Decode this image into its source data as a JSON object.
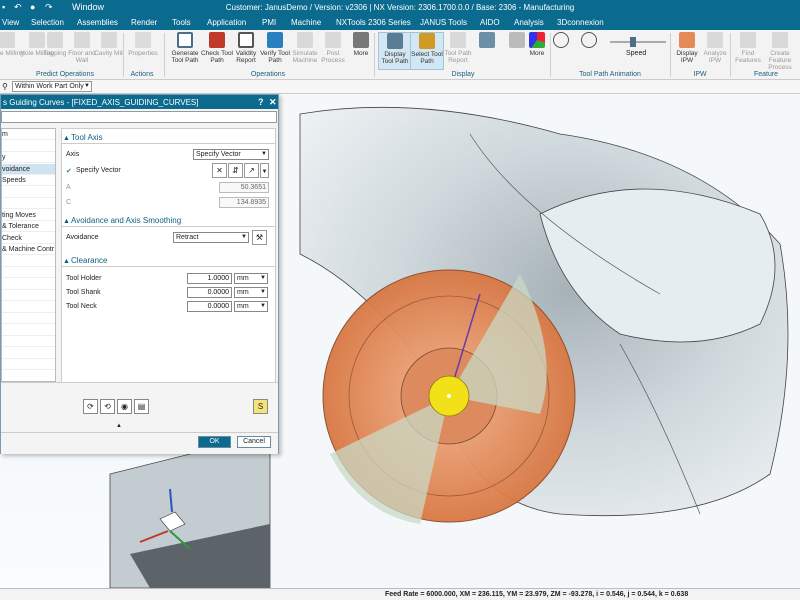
{
  "titlebar": {
    "title": "Customer: JanusDemo / Version: v2306 | NX Version: 2306.1700.0.0 / Base: 2306 - Manufacturing",
    "window_menu": "Window"
  },
  "menubar": {
    "items": [
      "View",
      "Selection",
      "Assemblies",
      "Render",
      "Tools",
      "Application",
      "PMI",
      "Machine",
      "NXTools 2306 Series",
      "JANUS Tools",
      "AIDO",
      "Analysis",
      "3Dconnexion"
    ]
  },
  "ribbon": {
    "groups": {
      "predict": "Predict Operations",
      "actions": "Actions",
      "operations": "Operations",
      "display": "Display",
      "animation": "Tool Path Animation",
      "ipw": "IPW",
      "feature": "Feature"
    },
    "buttons": {
      "hole_milling": "Hole Milling",
      "tapping": "Tapping",
      "floor_wall": "Floor and Wall",
      "cavity_mill": "Cavity Mill",
      "properties": "Properties",
      "generate": "Generate Tool Path",
      "check": "Check Tool Path",
      "validity": "Validity Report",
      "verify": "Verify Tool Path",
      "simulate": "Simulate Machine",
      "post": "Post Process",
      "more1": "More",
      "display_tp": "Display Tool Path",
      "select_tp": "Select Tool Path",
      "tp_report": "Tool Path Report",
      "more2": "More",
      "speed": "Speed",
      "display_ipw": "Display IPW",
      "analyze_ipw": "Analyze IPW",
      "find_features": "Find Features",
      "create_feature": "Create Feature Process"
    }
  },
  "filter": {
    "value": "Within Work Part Only"
  },
  "dialog": {
    "title": "s Guiding Curves - [FIXED_AXIS_GUIDING_CURVES]",
    "help": "?",
    "close": "✕",
    "nav_items": [
      "m",
      "",
      "y",
      "voidance",
      "Speeds",
      "",
      "",
      "ting Moves",
      "& Tolerance",
      "Check",
      "& Machine Contr",
      "",
      "",
      "",
      "",
      "",
      "",
      "",
      "",
      "",
      "",
      ""
    ],
    "nav_selected_index": 3,
    "tool_axis": {
      "header": "Tool Axis",
      "axis_label": "Axis",
      "axis_value": "Specify Vector",
      "specify_vector": "Specify Vector",
      "a_label": "A",
      "a_value": "50.3651",
      "c_label": "C",
      "c_value": "134.8935"
    },
    "avoidance": {
      "header": "Avoidance and Axis Smoothing",
      "label": "Avoidance",
      "value": "Retract"
    },
    "clearance": {
      "header": "Clearance",
      "rows": [
        {
          "label": "Tool Holder",
          "value": "1.0000",
          "unit": "mm"
        },
        {
          "label": "Tool Shank",
          "value": "0.0000",
          "unit": "mm"
        },
        {
          "label": "Tool Neck",
          "value": "0.0000",
          "unit": "mm"
        }
      ]
    },
    "ok": "OK",
    "cancel": "Cancel"
  },
  "status": {
    "text": "Feed Rate = 6000.000, XM = 236.115, YM = 23.979, ZM = -93.278, i = 0.546, j = 0.544, k = 0.638"
  },
  "colors": {
    "accent": "#0a6b8f",
    "tool_orange": "#e58a56",
    "tool_center": "#f2e018",
    "part_grey": "#c9d3d8"
  }
}
